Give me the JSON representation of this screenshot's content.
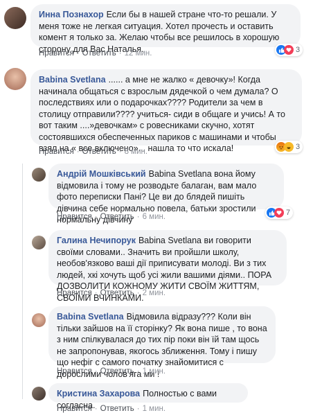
{
  "comments": [
    {
      "author": "Инна Познахор",
      "text": "Если бы в нашей стране что-то решали. У меня тоже не легкая ситуация. Хотел прочесть и оставить комент я только за. Желаю чтобы все решилось в хорошую сторону для Вас Наталья.",
      "like": "Нравится",
      "reply": "Ответить",
      "time": "12 мин.",
      "reaction_count": "3"
    },
    {
      "author": "Babina Svetlana",
      "text": "...... а мне не жалко « девочку»! Когда начинала общаться с взрослым дядечкой о чем думала? О последствиях или о подарочках???? Родители за чем в столицу отправили???? учиться- сиди в общаге и учись! А то вот таким ....»девочкам» с ровесниками скучно, хотят состоявшихся обеспеченных париков с машинами и чтобы взял на « все включено»... нашла то что искала!",
      "like": "Нравится",
      "reply": "Ответить",
      "time": "8 мин.",
      "reaction_count": "3"
    },
    {
      "author": "Андрій Мошківський",
      "text": "Babina Svetlana вона йому відмовила і тому не розводьте балаган, вам мало фото переписки Пані? Це ви до блядей пишіть дівчина себе нормально повела, батьки зростили нормальну дівчину",
      "like": "Нравится",
      "reply": "Ответить",
      "time": "6 мин.",
      "reaction_count": "7"
    },
    {
      "author": "Галина Нечипорук",
      "text": "Babina Svetlana ви говорити своїми словами.. Значить ви пройшли школу, необов'язково ваші дії приписувати молоді. Ви з тих людей, хкі хочуть щоб усі жили вашими діями.. ПОРА ДОЗВОЛИТИ КОЖНОМУ ЖИТИ СВОЇМ ЖИТТЯМ, СВОЇМИ ВЧИНКАМИ.",
      "like": "Нравится",
      "reply": "Ответить",
      "time": "2 мин."
    },
    {
      "author": "Babina Svetlana",
      "text": "Відмовила відразу??? Коли він тільки зайшов на її сторінку? Як вона пише , то вона з ним спілкувалася до тих пір поки він їй там щось не запропонував, якогось зближення. Тому і пишу що нефіг с самого початку знайомитися с дорослими чолов'яга ми !",
      "like": "Нравится",
      "reply": "Ответить",
      "time": "1 мин."
    },
    {
      "author": "Кристина Захарова",
      "text": "Полностью с вами согласна.",
      "like": "Нравится",
      "reply": "Ответить",
      "time": "1 мин."
    }
  ]
}
